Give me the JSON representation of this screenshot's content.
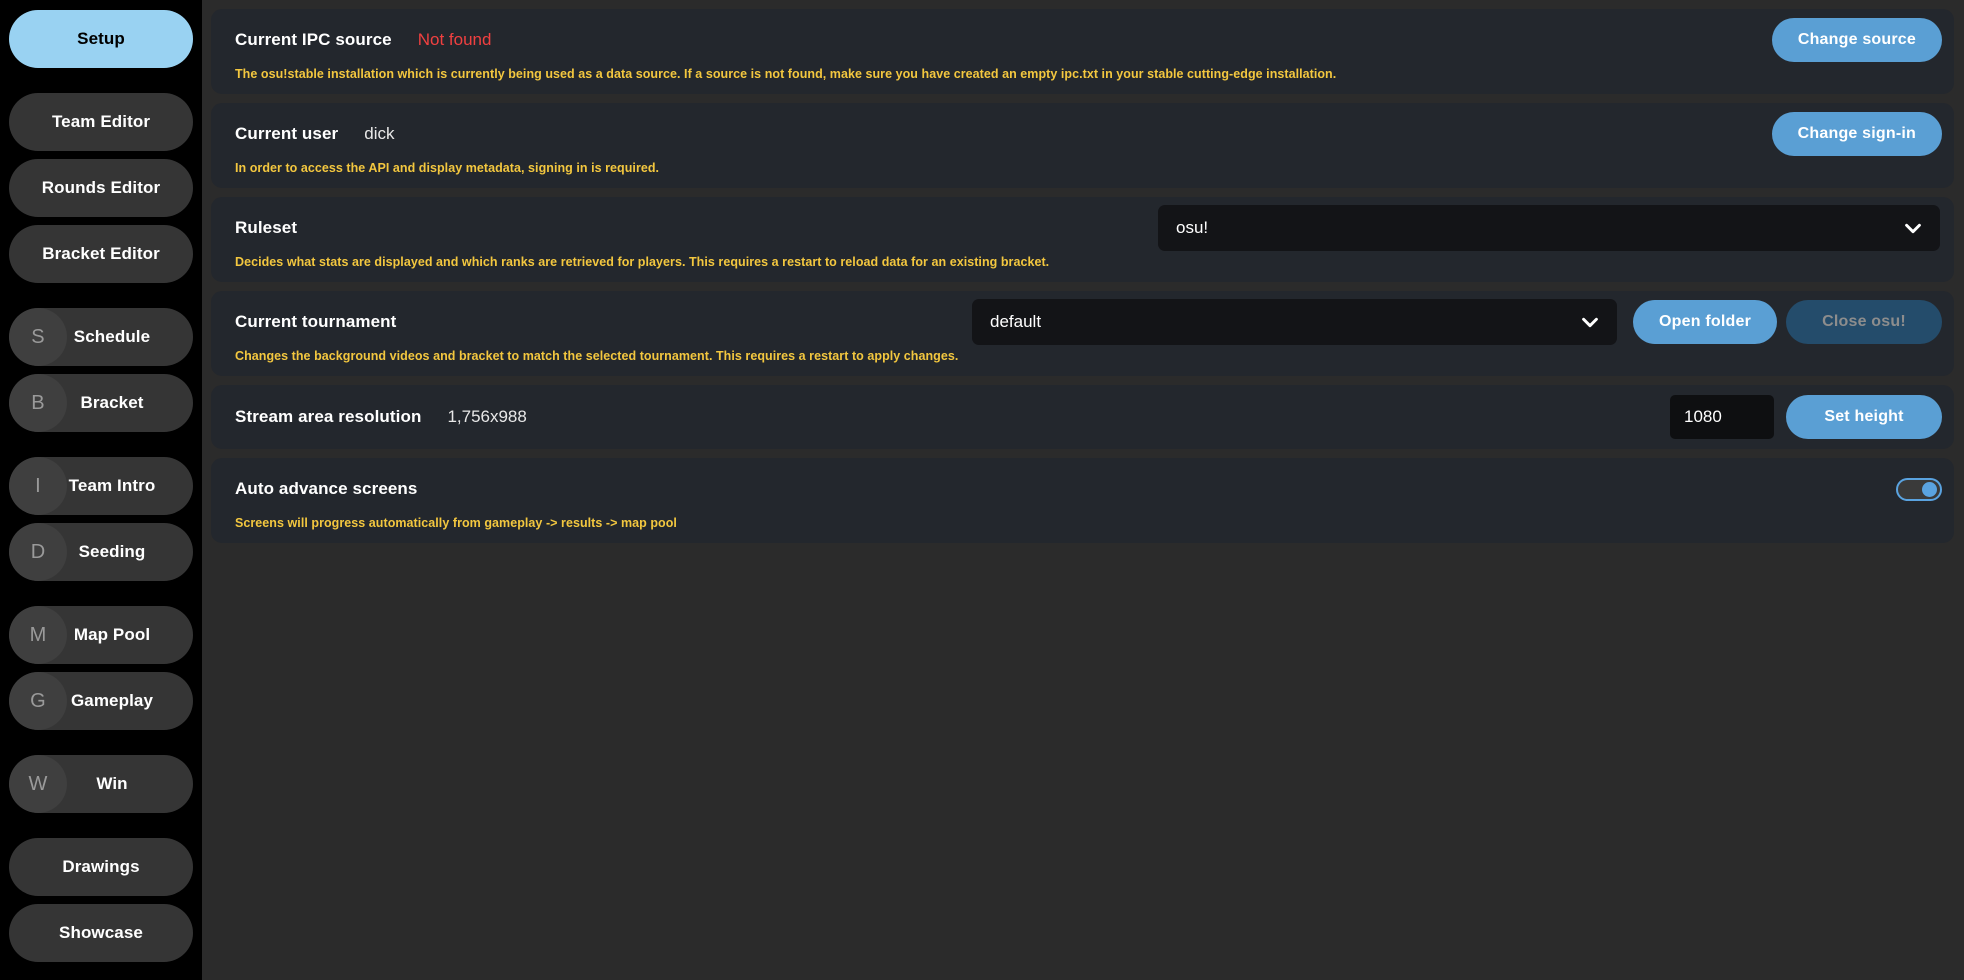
{
  "sidebar": {
    "groups": [
      {
        "items": [
          {
            "label": "Setup",
            "badge": "",
            "active": true
          }
        ]
      },
      {
        "items": [
          {
            "label": "Team Editor",
            "badge": "",
            "active": false
          },
          {
            "label": "Rounds Editor",
            "badge": "",
            "active": false
          },
          {
            "label": "Bracket Editor",
            "badge": "",
            "active": false
          }
        ]
      },
      {
        "items": [
          {
            "label": "Schedule",
            "badge": "S",
            "active": false
          },
          {
            "label": "Bracket",
            "badge": "B",
            "active": false
          }
        ]
      },
      {
        "items": [
          {
            "label": "Team Intro",
            "badge": "I",
            "active": false
          },
          {
            "label": "Seeding",
            "badge": "D",
            "active": false
          }
        ]
      },
      {
        "items": [
          {
            "label": "Map Pool",
            "badge": "M",
            "active": false
          },
          {
            "label": "Gameplay",
            "badge": "G",
            "active": false
          }
        ]
      },
      {
        "items": [
          {
            "label": "Win",
            "badge": "W",
            "active": false
          }
        ]
      },
      {
        "items": [
          {
            "label": "Drawings",
            "badge": "",
            "active": false
          },
          {
            "label": "Showcase",
            "badge": "",
            "active": false
          }
        ]
      }
    ]
  },
  "rows": {
    "ipc": {
      "label": "Current IPC source",
      "value": "Not found",
      "button": "Change source",
      "description": "The osu!stable installation which is currently being used as a data source. If a source is not found, make sure you have created an empty ipc.txt in your stable cutting-edge installation."
    },
    "user": {
      "label": "Current user",
      "value": "dick",
      "button": "Change sign-in",
      "description": "In order to access the API and display metadata, signing in is required."
    },
    "ruleset": {
      "label": "Ruleset",
      "selected": "osu!",
      "description": "Decides what stats are displayed and which ranks are retrieved for players. This requires a restart to reload data for an existing bracket."
    },
    "tournament": {
      "label": "Current tournament",
      "selected": "default",
      "open_folder_button": "Open folder",
      "close_button": "Close osu!",
      "description": "Changes the background videos and bracket to match the selected tournament. This requires a restart to apply changes."
    },
    "resolution": {
      "label": "Stream area resolution",
      "value": "1,756x988",
      "height_input": "1080",
      "button": "Set height"
    },
    "auto_advance": {
      "label": "Auto advance screens",
      "description": "Screens will progress automatically from gameplay -> results -> map pool",
      "enabled": true
    }
  },
  "colors": {
    "accent_blue": "#5a9fd4",
    "active_nav": "#99d2f2",
    "warning_yellow": "#f3c73f",
    "danger_red": "#f04040",
    "disabled_blue": "#244c6b"
  }
}
